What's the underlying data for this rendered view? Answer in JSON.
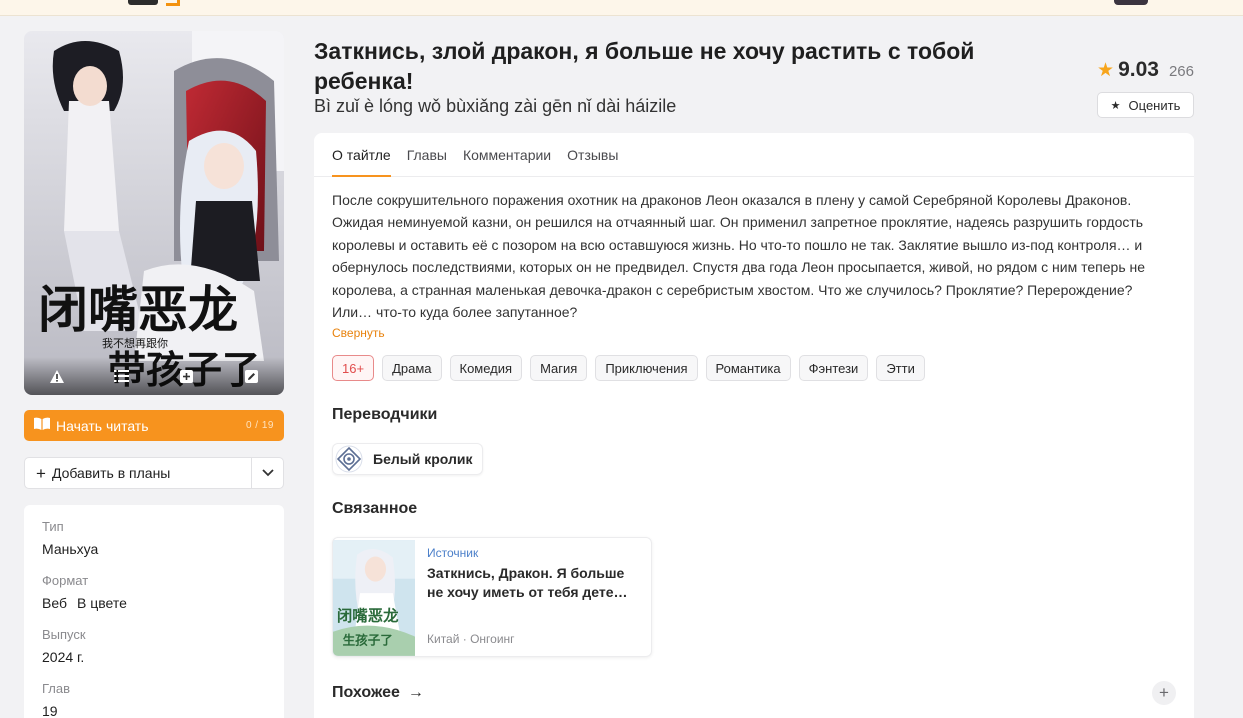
{
  "manga": {
    "title": "Заткнись, злой дракон, я больше не хочу растить с тобой ребенка!",
    "alt_title": "Bì zuǐ è lóng wǒ bùxiǎng zài gēn nǐ dài háizile",
    "rating": "9.03",
    "votes": "266",
    "rate_label": "Оценить",
    "cover_text": "闭嘴恶龙 我不想再跟你 带孩子了"
  },
  "actions": {
    "read_label": "Начать читать",
    "read_progress": "0 / 19",
    "plans_label": "Добавить в планы"
  },
  "info": [
    {
      "key": "Тип",
      "value": "Маньхуа"
    },
    {
      "key": "Формат",
      "value": "Веб",
      "value2": "В цвете"
    },
    {
      "key": "Выпуск",
      "value": "2024 г."
    },
    {
      "key": "Глав",
      "value": "19"
    }
  ],
  "tabs": [
    {
      "label": "О тайтле"
    },
    {
      "label": "Главы"
    },
    {
      "label": "Комментарии"
    },
    {
      "label": "Отзывы"
    }
  ],
  "description": "После сокрушительного поражения охотник на драконов Леон оказался в плену у самой Серебряной Королевы Драконов. Ожидая неминуемой казни, он решился на отчаянный шаг. Он применил запретное проклятие, надеясь разрушить гордость королевы и оставить её с позором на всю оставшуюся жизнь. Но что-то пошло не так. Заклятие вышло из-под контроля… и обернулось последствиями, которых он не предвидел. Спустя два года Леон просыпается, живой, но рядом с ним теперь не королева, а странная маленькая девочка-дракон с серебристым хвостом. Что же случилось? Проклятие? Перерождение? Или… что-то куда более запутанное?",
  "collapse_label": "Свернуть",
  "tags": [
    "16+",
    "Драма",
    "Комедия",
    "Магия",
    "Приключения",
    "Романтика",
    "Фэнтези",
    "Этти"
  ],
  "sections": {
    "translators": "Переводчики",
    "related": "Связанное",
    "similar": "Похожее"
  },
  "translator": {
    "name": "Белый кролик"
  },
  "related_item": {
    "kind": "Источник",
    "title": "Заткнись, Дракон. Я больше не хочу иметь от тебя дете…",
    "subtitle": "Китай · Онгоинг"
  },
  "colors": {
    "accent": "#f7931e",
    "link": "#4b7fc9",
    "age_tag": "#e14d4d"
  },
  "icons": [
    "warning-icon",
    "list-icon",
    "plus-square-icon",
    "edit-icon",
    "book-open-icon",
    "plus-icon",
    "chevron-down-icon",
    "star-icon",
    "arrow-right-icon"
  ]
}
